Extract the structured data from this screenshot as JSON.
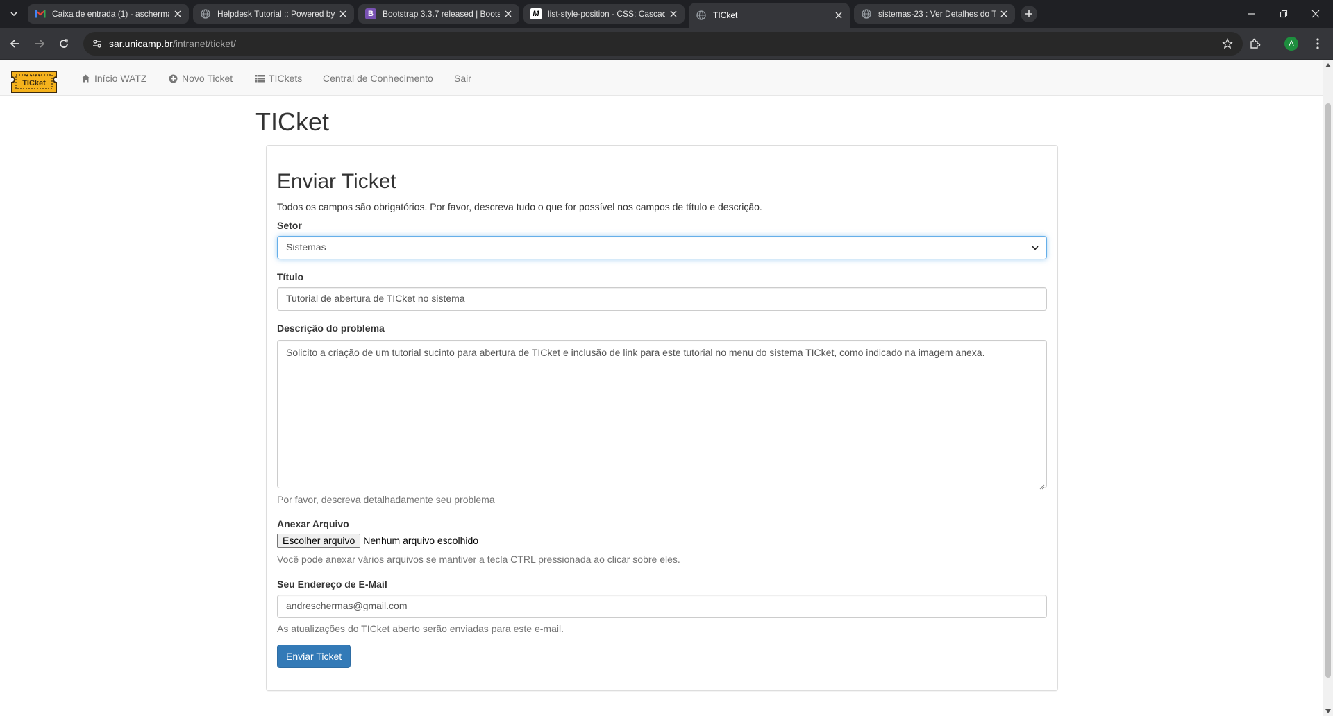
{
  "browser": {
    "tabs": [
      {
        "title": "Caixa de entrada (1) - ascherma",
        "favicon": "gmail-icon",
        "active": false
      },
      {
        "title": "Helpdesk Tutorial :: Powered by",
        "favicon": "globe-icon",
        "active": false
      },
      {
        "title": "Bootstrap 3.3.7 released | Boots",
        "favicon": "bootstrap-icon",
        "active": false
      },
      {
        "title": "list-style-position - CSS: Cascad",
        "favicon": "mdn-icon",
        "active": false
      },
      {
        "title": "TICket",
        "favicon": "globe-icon",
        "active": true
      },
      {
        "title": "sistemas-23 : Ver Detalhes do T",
        "favicon": "globe-icon",
        "active": false
      }
    ],
    "bootstrap_favicon_letter": "B",
    "mdn_favicon_letter": "M",
    "url_host": "sar.unicamp.br",
    "url_path": "/intranet/ticket/",
    "profile_initial": "A"
  },
  "navbar": {
    "brand_text": "TICket",
    "items": [
      {
        "label": "Início WATZ",
        "icon": "home-icon"
      },
      {
        "label": "Novo Ticket",
        "icon": "plus-circle-icon"
      },
      {
        "label": "TICkets",
        "icon": "list-icon"
      },
      {
        "label": "Central de Conhecimento",
        "icon": ""
      },
      {
        "label": "Sair",
        "icon": ""
      }
    ]
  },
  "page": {
    "title": "TICket"
  },
  "form": {
    "heading": "Enviar Ticket",
    "intro": "Todos os campos são obrigatórios. Por favor, descreva tudo o que for possível nos campos de título e descrição.",
    "setor": {
      "label": "Setor",
      "value": "Sistemas"
    },
    "titulo": {
      "label": "Título",
      "value": "Tutorial de abertura de TICket no sistema"
    },
    "descricao": {
      "label": "Descrição do problema",
      "value": "Solicito a criação de um tutorial sucinto para abertura de TICket e inclusão de link para este tutorial no menu do sistema TICket, como indicado na imagem anexa.",
      "help": "Por favor, descreva detalhadamente seu problema"
    },
    "anexo": {
      "label": "Anexar Arquivo",
      "button": "Escolher arquivo",
      "status": "Nenhum arquivo escolhido",
      "help": "Você pode anexar vários arquivos se mantiver a tecla CTRL pressionada ao clicar sobre eles."
    },
    "email": {
      "label": "Seu Endereço de E-Mail",
      "value": "andreschermas@gmail.com",
      "help": "As atualizações do TICket aberto serão enviadas para este e-mail."
    },
    "submit_label": "Enviar Ticket"
  },
  "colors": {
    "primary": "#337ab7",
    "navbar_bg": "#f8f8f8",
    "chrome_dark": "#1f2024",
    "brand_yellow": "#f5b21c"
  }
}
